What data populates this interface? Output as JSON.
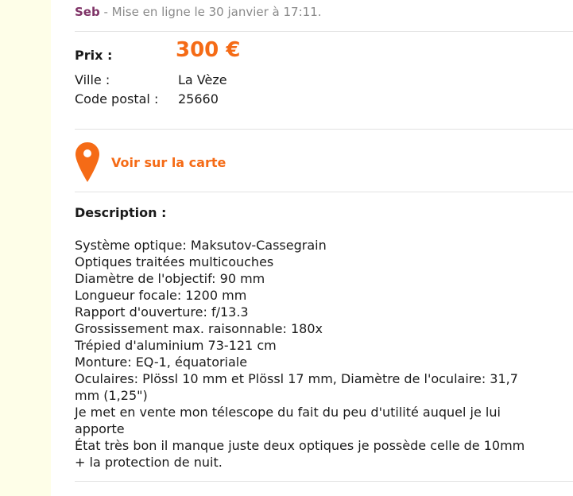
{
  "seller": {
    "name": "Seb",
    "posted": " - Mise en ligne le 30 janvier à 17:11."
  },
  "details": {
    "price_label": "Prix :",
    "price_value": "300 €",
    "city_label": "Ville :",
    "city_value": "La Vèze",
    "postal_label": "Code postal :",
    "postal_value": "25660"
  },
  "map": {
    "label": "Voir sur la carte",
    "icon": "map-pin-icon"
  },
  "description": {
    "title": "Description :",
    "body": "Système optique: Maksutov-Cassegrain\nOptiques traitées multicouches\nDiamètre de l'objectif: 90 mm\nLongueur focale: 1200 mm\nRapport d'ouverture: f/13.3\nGrossissement max. raisonnable: 180x\nTrépied d'aluminium 73-121 cm\nMonture: EQ-1, équatoriale\nOculaires: Plössl 10 mm et Plössl 17 mm, Diamètre de l'oculaire: 31,7\nmm (1,25\")\nJe met en vente mon télescope du fait du peu d'utilité auquel je lui\napporte\nÉtat très bon il manque juste deux optiques je possède celle de 10mm\n+ la protection de nuit."
  },
  "colors": {
    "accent": "#f56b16",
    "seller": "#7f3367",
    "left_strip": "#fefee8"
  }
}
